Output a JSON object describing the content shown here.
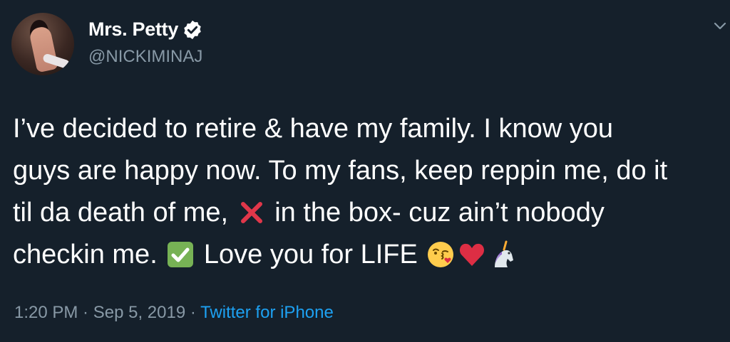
{
  "user": {
    "display_name": "Mrs. Petty",
    "handle": "@NICKIMINAJ",
    "verified": true,
    "avatar_icon": "profile-photo"
  },
  "tweet": {
    "line1": "I’ve decided to retire & have my family. I know you",
    "line2": "guys are happy now. To my fans, keep reppin me, do it",
    "line3_a": "til da death of me,",
    "line3_b": "in the box- cuz ain’t nobody",
    "line4_a": "checkin me.",
    "line4_b": "Love you for LIFE",
    "emojis": [
      "cross-mark-icon",
      "check-mark-button-icon",
      "kissing-face-icon",
      "red-heart-icon",
      "unicorn-icon"
    ]
  },
  "meta": {
    "time": "1:20 PM",
    "separator": " · ",
    "date": "Sep 5, 2019",
    "source": "Twitter for iPhone"
  },
  "colors": {
    "background": "#15202b",
    "text": "#ffffff",
    "muted": "#8899a6",
    "link": "#1da1f2"
  }
}
